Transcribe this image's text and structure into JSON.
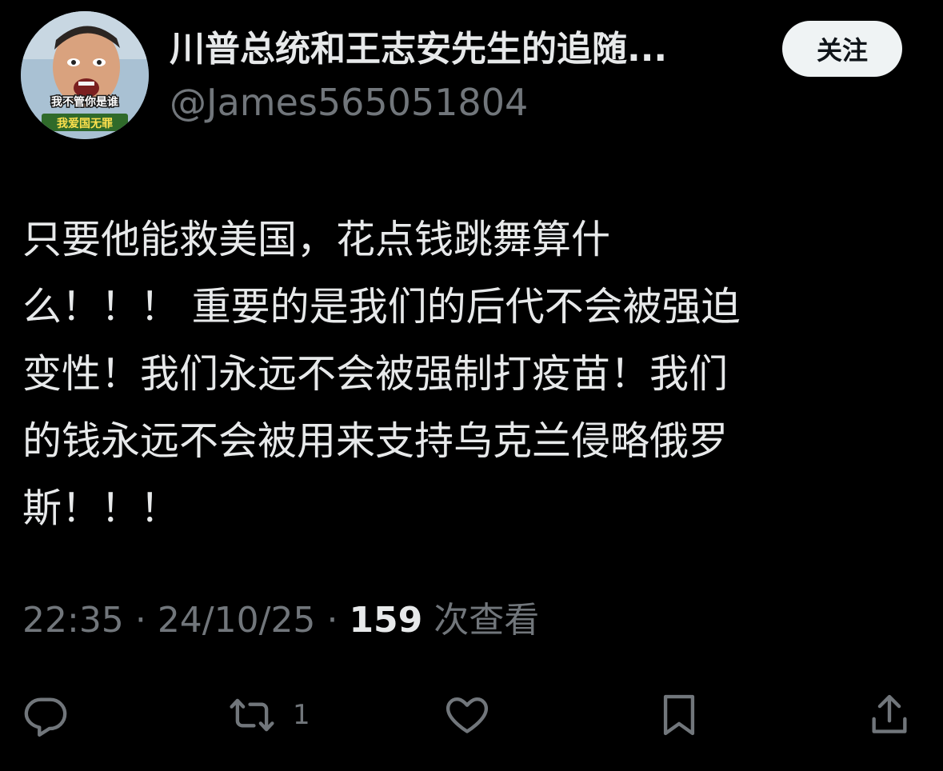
{
  "author": {
    "display_name": "川普总统和王志安先生的追随...",
    "handle": "@James565051804",
    "avatar_caption_top": "我不管你是谁",
    "avatar_caption_bottom": "我爱国无罪"
  },
  "follow_label": "关注",
  "tweet": {
    "lines": [
      "只要他能救美国，花点钱跳舞算什",
      "么！！！ 重要的是我们的后代不会被强迫",
      "变性！我们永远不会被强制打疫苗！我们",
      "的钱永远不会被用来支持乌克兰侵略俄罗",
      "斯！！！"
    ]
  },
  "meta": {
    "time": "22:35",
    "separator": "·",
    "date": "24/10/25",
    "view_count": "159",
    "views_label": "次查看"
  },
  "actions": {
    "reply_icon": "reply-icon",
    "retweet_icon": "retweet-icon",
    "retweet_count": "1",
    "like_icon": "heart-icon",
    "bookmark_icon": "bookmark-icon",
    "share_icon": "share-icon"
  },
  "colors": {
    "background": "#000000",
    "primary_text": "#e7e9ea",
    "secondary_text": "#71767b",
    "follow_button_bg": "#eff3f4",
    "follow_button_text": "#0f1419"
  }
}
